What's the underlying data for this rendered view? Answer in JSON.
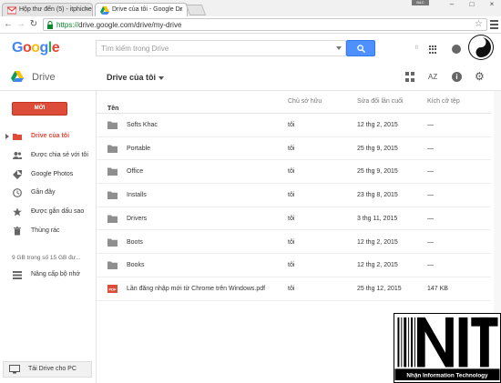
{
  "browser": {
    "tabs": [
      {
        "label": "Hộp thư đến (5) - itphiche"
      },
      {
        "label": "Drive của tôi - Google Dr"
      }
    ],
    "url_scheme": "https://",
    "url_rest": "drive.google.com/drive/my-drive",
    "window_user_label": "B&C"
  },
  "header": {
    "logo": "Google",
    "search_placeholder": "Tìm kiếm trong Drive",
    "lang_hint": "lt"
  },
  "drive": {
    "app_title": "Drive",
    "folder_title": "Drive của tôi",
    "sort_label": "AZ"
  },
  "sidebar": {
    "new_label": "MỚI",
    "items": [
      {
        "label": "Drive của tôi",
        "icon": "drive-folder-icon"
      },
      {
        "label": "Được chia sẻ với tôi",
        "icon": "people-icon"
      },
      {
        "label": "Google Photos",
        "icon": "photos-icon"
      },
      {
        "label": "Gần đây",
        "icon": "clock-icon"
      },
      {
        "label": "Được gắn dấu sao",
        "icon": "star-icon"
      },
      {
        "label": "Thùng rác",
        "icon": "trash-icon"
      }
    ],
    "storage": "9 GB trong số 15 GB đư...",
    "upgrade": "Nâng cấp bộ nhớ",
    "download": "Tải Drive cho PC"
  },
  "table": {
    "headers": {
      "name": "Tên",
      "owner": "Chủ sở hữu",
      "modified": "Sửa đổi lần cuối",
      "size": "Kích cỡ tệp"
    },
    "rows": [
      {
        "name": "Softs Khac",
        "owner": "tôi",
        "modified": "12 thg 2, 2015",
        "size": "—",
        "type": "folder"
      },
      {
        "name": "Portable",
        "owner": "tôi",
        "modified": "25 thg 9, 2015",
        "size": "—",
        "type": "folder"
      },
      {
        "name": "Office",
        "owner": "tôi",
        "modified": "25 thg 9, 2015",
        "size": "—",
        "type": "folder"
      },
      {
        "name": "Installs",
        "owner": "tôi",
        "modified": "23 thg 8, 2015",
        "size": "—",
        "type": "folder"
      },
      {
        "name": "Drivers",
        "owner": "tôi",
        "modified": "3 thg 11, 2015",
        "size": "—",
        "type": "folder"
      },
      {
        "name": "Boots",
        "owner": "tôi",
        "modified": "12 thg 2, 2015",
        "size": "—",
        "type": "folder"
      },
      {
        "name": "Books",
        "owner": "tôi",
        "modified": "12 thg 2, 2015",
        "size": "—",
        "type": "folder"
      },
      {
        "name": "Lần đăng nhập mới từ Chrome trên Windows.pdf",
        "owner": "tôi",
        "modified": "25 thg 12, 2015",
        "size": "147 KB",
        "type": "pdf"
      }
    ]
  },
  "watermark": {
    "brand": "NIT",
    "tagline": "Nhận Information Technology"
  },
  "colors": {
    "accent_red": "#dd4b39",
    "search_blue": "#4d90fe",
    "url_green": "#0a8a2a"
  }
}
